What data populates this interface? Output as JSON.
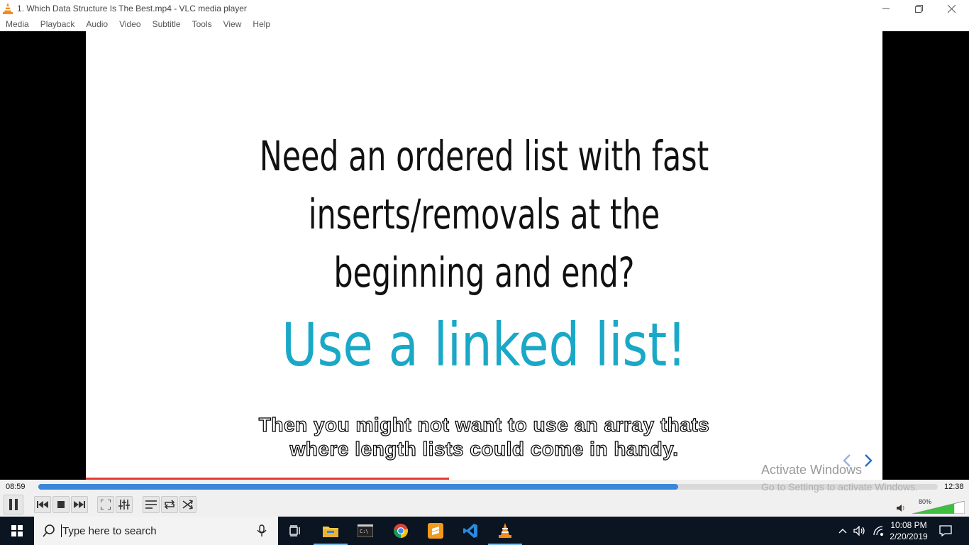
{
  "window": {
    "title": "1. Which Data Structure Is The Best.mp4 - VLC media player"
  },
  "menu": [
    "Media",
    "Playback",
    "Audio",
    "Video",
    "Subtitle",
    "Tools",
    "View",
    "Help"
  ],
  "slide": {
    "question_lines": [
      "Need an ordered list with fast",
      "inserts/removals at the",
      "beginning and end?"
    ],
    "answer": "Use a linked list!",
    "answer_color": "#1aa8c7"
  },
  "subtitle": {
    "line1": "Then you might not want to use an array thats",
    "line2": "where length lists could come in handy."
  },
  "watermark": {
    "line1": "Activate Windows",
    "line2": "Go to Settings to activate Windows."
  },
  "player": {
    "time_elapsed": "08:59",
    "time_total": "12:38",
    "position_fraction": 0.711,
    "volume_percent": "80%",
    "volume_fraction": 0.8,
    "accent": "#3a86d9"
  },
  "taskbar": {
    "search_placeholder": "Type here to search",
    "time": "10:08 PM",
    "date": "2/20/2019",
    "apps": [
      "task-view",
      "file-explorer",
      "terminal",
      "chrome",
      "sublime-text",
      "vscode",
      "vlc"
    ]
  }
}
